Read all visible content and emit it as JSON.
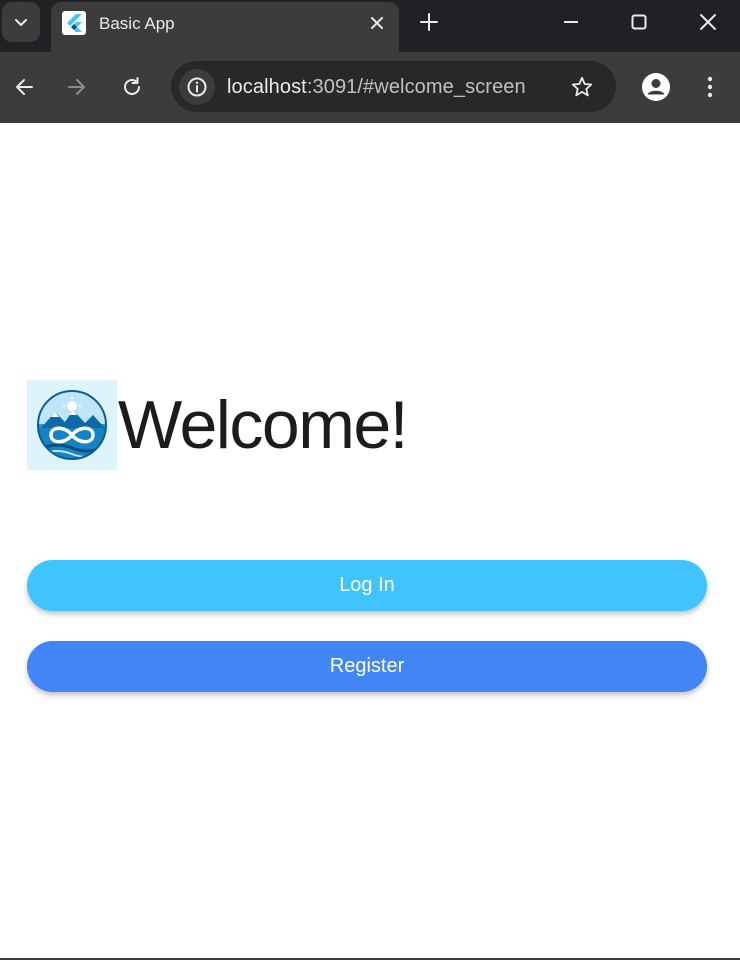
{
  "browser": {
    "tab": {
      "title": "Basic App",
      "favicon": "flutter-logo-icon"
    },
    "tabbar_icons": {
      "tab_search": "chevron-down-icon",
      "close_tab": "close-icon",
      "new_tab": "plus-icon",
      "minimize": "minimize-icon",
      "maximize": "maximize-icon",
      "close_window": "close-icon"
    },
    "toolbar_icons": {
      "back": "arrow-left-icon",
      "forward": "arrow-right-icon",
      "reload": "reload-icon",
      "site_info": "info-icon",
      "bookmark": "star-icon",
      "profile": "person-icon",
      "menu": "more-vert-icon"
    },
    "address": {
      "host": "localhost",
      "rest": ":3091/#welcome_screen"
    },
    "colors": {
      "chrome_dark": "#202124",
      "chrome": "#3c3c3c",
      "omnibox": "#282828"
    }
  },
  "page": {
    "logo": "app-logo-icon",
    "heading": "Welcome!",
    "buttons": {
      "login": "Log In",
      "register": "Register"
    },
    "colors": {
      "login": "#40c4ff",
      "register": "#4285f4",
      "heading": "#1c1b1f"
    }
  }
}
